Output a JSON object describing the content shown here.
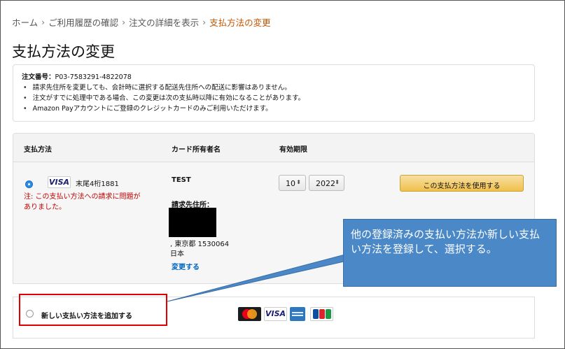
{
  "breadcrumb": {
    "items": [
      "ホーム",
      "ご利用履歴の確認",
      "注文の詳細を表示"
    ],
    "current": "支払方法の変更",
    "separator": "›"
  },
  "page": {
    "title": "支払方法の変更"
  },
  "notice": {
    "order_label": "注文番号：",
    "order_number": "P03-7583291-4822078",
    "bullets": [
      "請求先住所を変更しても、会計時に選択する配送先住所への配送に影響はありません。",
      "注文がすでに処理中である場合、この変更は次の支払時以降に有効になることがあります。",
      "Amazon Payアカウントにご登録のクレジットカードのみご利用いただけます。"
    ]
  },
  "table": {
    "headers": {
      "method": "支払方法",
      "holder": "カード所有者名",
      "expiry": "有効期限"
    },
    "card": {
      "brand": "VISA",
      "tail": "末尾4桁1881",
      "warning": "注: この支払い方法への請求に問題がありました。",
      "holder_name": "TEST",
      "billing_label": "請求先住所：",
      "address_line": ", 東京都 1530064",
      "country": "日本",
      "change_link": "変更する",
      "month": "10",
      "year": "2022",
      "use_button": "この支払方法を使用する"
    }
  },
  "add_method": {
    "label": "新しい支払い方法を追加する",
    "logos": [
      "mastercard-logo",
      "visa-logo",
      "amex-logo",
      "jcb-logo"
    ]
  },
  "callout": {
    "text": "他の登録済みの支払い方法か新しい支払い方法を登録して、選択する。"
  },
  "colors": {
    "breadcrumb_current": "#c45500",
    "warning": "#c40000",
    "link": "#0066c0",
    "button": "#f0c14b",
    "callout": "#4a88c8",
    "highlight": "#e00000",
    "radio_selected": "#2b8be6"
  }
}
